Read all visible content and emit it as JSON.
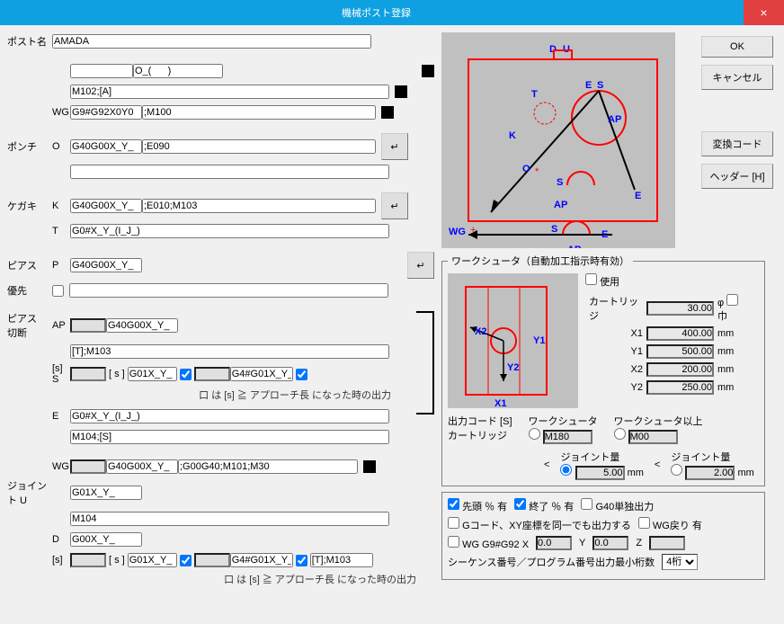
{
  "window": {
    "title": "機械ポスト登録",
    "close": "×"
  },
  "buttons": {
    "ok": "OK",
    "cancel": "キャンセル",
    "convert": "変換コード",
    "header": "ヘッダー [H]"
  },
  "labels": {
    "postname": "ポスト名",
    "wg": "WG",
    "punch": "ポンチ",
    "punch_o": "O",
    "kegaki": "ケガキ",
    "kegaki_k": "K",
    "kegaki_t": "T",
    "pias": "ピアス",
    "pias_p": "P",
    "yusen": "優先",
    "piascut": "ピアス\n切断",
    "ap": "AP",
    "s": "[s] S",
    "e": "E",
    "wg2": "WG",
    "joint": "ジョイント U",
    "joint_d": "D",
    "s2": "[s]",
    "note1": "口 は [s] ≧ アプローチ長 になった時の出力",
    "note2": "口 は [s] ≧ アプローチ長 になった時の出力",
    "s_checkbox": "[ s ]"
  },
  "values": {
    "postname": "AMADA",
    "line2a": "",
    "line2b": "O_(      )",
    "line3": "M102;[A]",
    "wg1": "G9#G92X0Y0",
    "wg1b": ";M100",
    "punch_o": "G40G00X_Y_",
    "punch_ob": ";E090",
    "punch_2": "",
    "kegaki_k": "G40G00X_Y_",
    "kegaki_kb": ";E010;M103",
    "kegaki_t": "G0#X_Y_(I_J_)",
    "pias_p": "G40G00X_Y_",
    "pias_2": "",
    "ap": "G40G00X_Y_",
    "ap_t": "[T];M103",
    "s1": "",
    "s2": "G01X_Y_",
    "s3": "G4#G01X_Y_",
    "e1": "G0#X_Y_(I_J_)",
    "e2": "M104;[S]",
    "wg2a": "",
    "wg2b": "G40G00X_Y_",
    "wg2c": ";G00G40;M101;M30",
    "joint_u": "G01X_Y_",
    "joint_2": "M104",
    "joint_d": "G00X_Y_",
    "si1": "",
    "si2": "G01X_Y_",
    "si3": "G4#G01X_Y_",
    "si4": "[T];M103"
  },
  "ws": {
    "legend": "ワークシュータ（自動加工指示時有効）",
    "use": "使用",
    "cartridge": "カートリッジ",
    "cartridge_v": "30.00",
    "phi": "φ",
    "haba": "巾",
    "x1": "X1",
    "x1_v": "400.00",
    "y1": "Y1",
    "y1_v": "500.00",
    "x2": "X2",
    "x2_v": "200.00",
    "y2": "Y2",
    "y2_v": "250.00",
    "mm": "mm",
    "outcode": "出力コード  [S]",
    "cartridge2": "カートリッジ",
    "ws_label": "ワークシュータ",
    "ws_v": "M180",
    "ws_other": "ワークシュータ以上",
    "ws_other_v": "M00",
    "lt": "<",
    "joint_amt": "ジョイント量",
    "joint_v1": "5.00",
    "joint_v2": "2.00"
  },
  "bottom": {
    "sentou": "先頭 ％ 有",
    "shuryo": "終了 ％ 有",
    "g40": "G40単独出力",
    "gcode": "Gコード、XY座標を同一でも出力する",
    "wgback": "WG戻り 有",
    "wgg92": "WG G9#G92  X",
    "y": "Y",
    "z": "Z",
    "g92_x": "0.0",
    "g92_y": "0.0",
    "g92_z": "",
    "seq": "シーケンス番号／プログラム番号出力最小桁数",
    "seq_v": "4桁"
  }
}
